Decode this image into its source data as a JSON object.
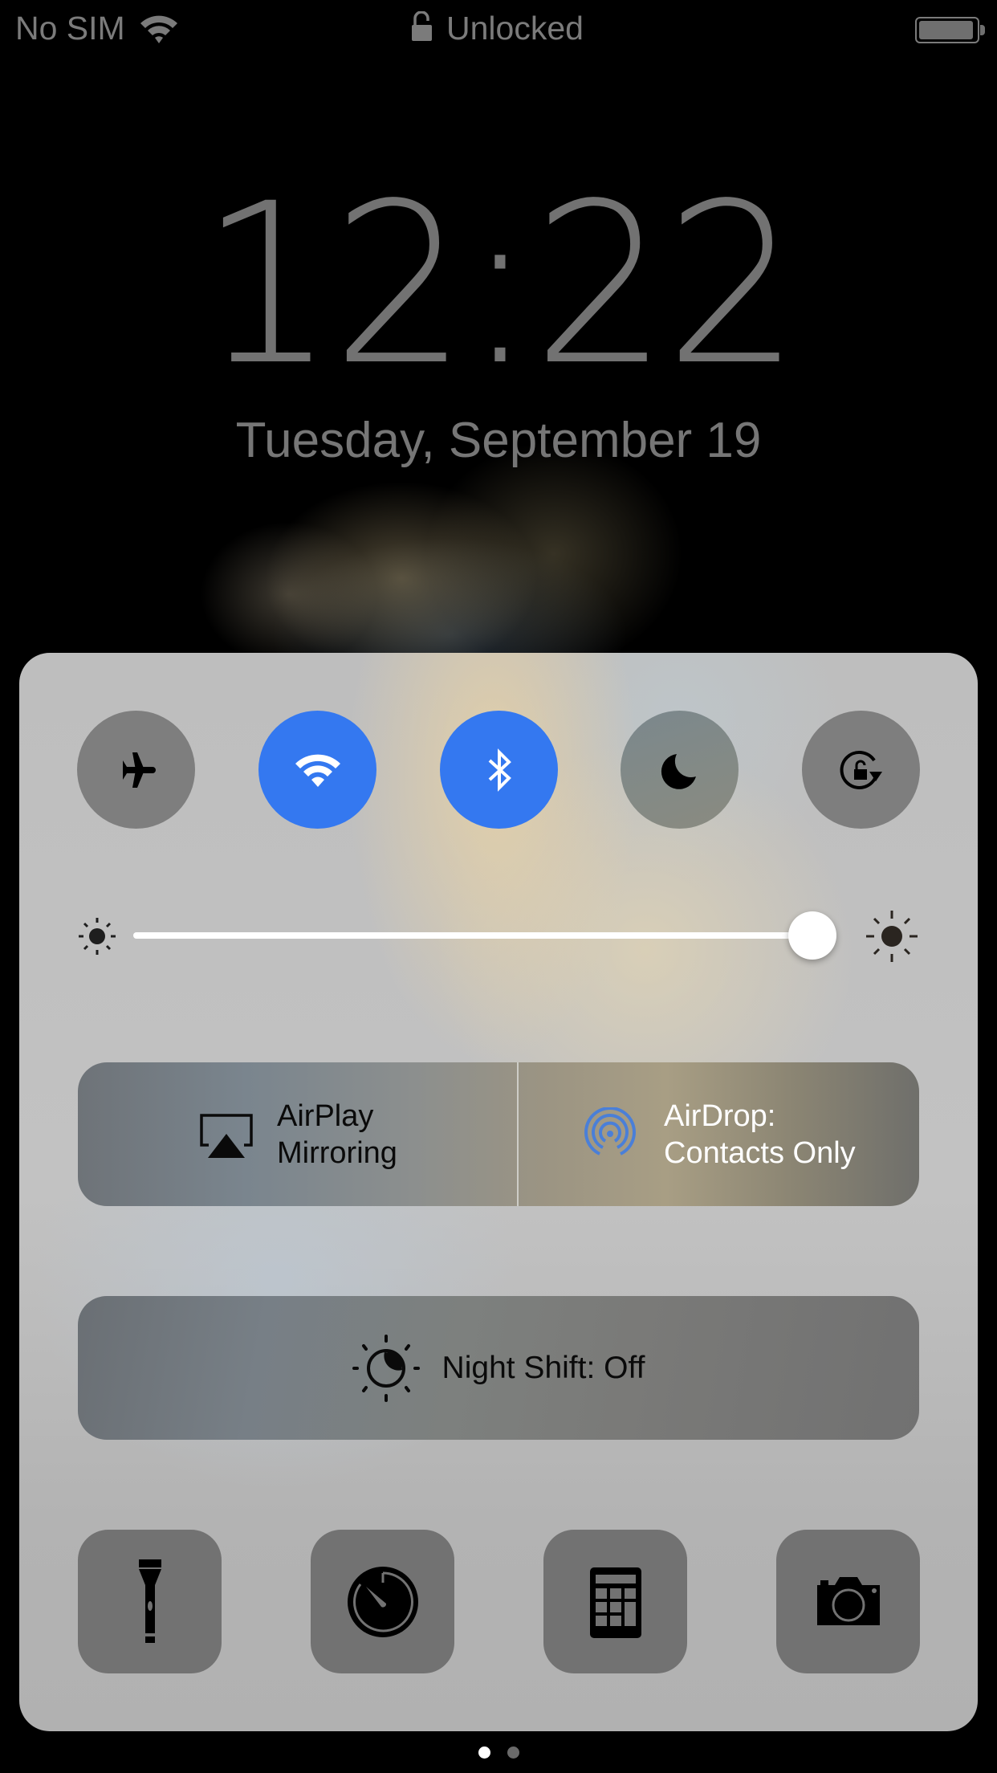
{
  "status_bar": {
    "carrier": "No SIM",
    "wifi_icon": "wifi-icon",
    "lock_icon": "unlocked-padlock-icon",
    "lock_status": "Unlocked",
    "battery_icon": "battery-icon",
    "battery_level": 0.95
  },
  "lock_screen": {
    "time": "12:22",
    "date": "Tuesday, September 19"
  },
  "control_center": {
    "toggles": [
      {
        "id": "airplane",
        "icon": "airplane-icon",
        "state": "off"
      },
      {
        "id": "wifi",
        "icon": "wifi-icon",
        "state": "on"
      },
      {
        "id": "bluetooth",
        "icon": "bluetooth-icon",
        "state": "on"
      },
      {
        "id": "do-not-disturb",
        "icon": "moon-icon",
        "state": "off"
      },
      {
        "id": "rotation-lock",
        "icon": "rotation-lock-icon",
        "state": "off"
      }
    ],
    "brightness": {
      "value": 1.0,
      "min_icon": "sun-small-icon",
      "max_icon": "sun-large-icon"
    },
    "airplay": {
      "icon": "airplay-icon",
      "line1": "AirPlay",
      "line2": "Mirroring"
    },
    "airdrop": {
      "icon": "airdrop-icon",
      "line1": "AirDrop:",
      "line2": "Contacts Only"
    },
    "night_shift": {
      "icon": "night-shift-icon",
      "label": "Night Shift: Off"
    },
    "shortcuts": [
      {
        "id": "flashlight",
        "icon": "flashlight-icon"
      },
      {
        "id": "timer",
        "icon": "timer-icon"
      },
      {
        "id": "calculator",
        "icon": "calculator-icon"
      },
      {
        "id": "camera",
        "icon": "camera-icon"
      }
    ]
  },
  "page_indicator": {
    "pages": 2,
    "current": 1
  },
  "colors": {
    "accent_on": "#3478f0",
    "toggle_off": "#7e7e7e",
    "tile": "#727272",
    "airdrop_blue": "#4a7fd8",
    "status_text": "#7b7b7b"
  }
}
